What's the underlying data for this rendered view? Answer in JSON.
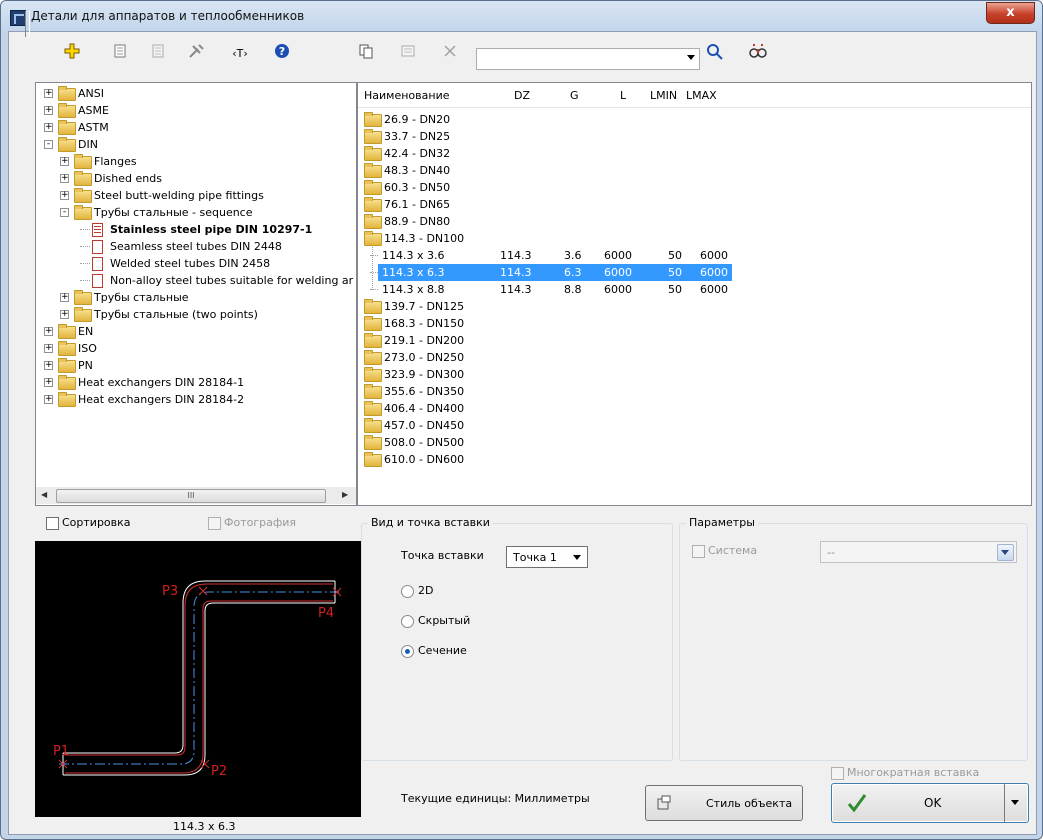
{
  "window": {
    "title": "Детали для аппаратов и теплообменников",
    "close_label": "x"
  },
  "toolbar": {
    "search_value": ""
  },
  "tree": {
    "scroll_label": "III",
    "items": [
      {
        "label": "ANSI",
        "level": 0,
        "type": "folder",
        "expander": "+"
      },
      {
        "label": "ASME",
        "level": 0,
        "type": "folder",
        "expander": "+"
      },
      {
        "label": "ASTM",
        "level": 0,
        "type": "folder",
        "expander": "+"
      },
      {
        "label": "DIN",
        "level": 0,
        "type": "folder-open",
        "expander": "-"
      },
      {
        "label": "Flanges",
        "level": 1,
        "type": "folder",
        "expander": "+"
      },
      {
        "label": "Dished ends",
        "level": 1,
        "type": "folder",
        "expander": "+"
      },
      {
        "label": "Steel butt-welding pipe fittings",
        "level": 1,
        "type": "folder",
        "expander": "+"
      },
      {
        "label": "Трубы стальные - sequence",
        "level": 1,
        "type": "folder-open",
        "expander": "-"
      },
      {
        "label": "Stainless steel pipe DIN 10297-1",
        "level": 2,
        "type": "doc-filled",
        "expander": "",
        "bold": true
      },
      {
        "label": "Seamless steel tubes DIN 2448",
        "level": 2,
        "type": "doc",
        "expander": ""
      },
      {
        "label": "Welded steel tubes DIN 2458",
        "level": 2,
        "type": "doc",
        "expander": ""
      },
      {
        "label": "Non-alloy steel tubes suitable for welding ar",
        "level": 2,
        "type": "doc",
        "expander": ""
      },
      {
        "label": "Трубы стальные",
        "level": 1,
        "type": "folder",
        "expander": "+"
      },
      {
        "label": "Трубы стальные (two points)",
        "level": 1,
        "type": "folder",
        "expander": "+"
      },
      {
        "label": "EN",
        "level": 0,
        "type": "folder",
        "expander": "+"
      },
      {
        "label": "ISO",
        "level": 0,
        "type": "folder",
        "expander": "+"
      },
      {
        "label": "PN",
        "level": 0,
        "type": "folder",
        "expander": "+"
      },
      {
        "label": "Heat exchangers DIN 28184-1",
        "level": 0,
        "type": "folder",
        "expander": "+"
      },
      {
        "label": "Heat exchangers DIN 28184-2",
        "level": 0,
        "type": "folder",
        "expander": "+"
      }
    ]
  },
  "list": {
    "columns": [
      "Наименование",
      "DZ",
      "G",
      "L",
      "LMIN",
      "LMAX"
    ],
    "rows": [
      {
        "name": "26.9 - DN20",
        "kind": "folder"
      },
      {
        "name": "33.7 - DN25",
        "kind": "folder"
      },
      {
        "name": "42.4 - DN32",
        "kind": "folder"
      },
      {
        "name": "48.3 - DN40",
        "kind": "folder"
      },
      {
        "name": "60.3 - DN50",
        "kind": "folder"
      },
      {
        "name": "76.1 - DN65",
        "kind": "folder"
      },
      {
        "name": "88.9 - DN80",
        "kind": "folder"
      },
      {
        "name": "114.3 - DN100",
        "kind": "folder-open"
      },
      {
        "name": "114.3 x 3.6",
        "kind": "item",
        "dz": "114.3",
        "g": "3.6",
        "l": "6000",
        "lmin": "50",
        "lmax": "6000"
      },
      {
        "name": "114.3 x 6.3",
        "kind": "item",
        "dz": "114.3",
        "g": "6.3",
        "l": "6000",
        "lmin": "50",
        "lmax": "6000",
        "selected": true
      },
      {
        "name": "114.3 x 8.8",
        "kind": "item",
        "dz": "114.3",
        "g": "8.8",
        "l": "6000",
        "lmin": "50",
        "lmax": "6000"
      },
      {
        "name": "139.7 - DN125",
        "kind": "folder"
      },
      {
        "name": "168.3 - DN150",
        "kind": "folder"
      },
      {
        "name": "219.1 - DN200",
        "kind": "folder"
      },
      {
        "name": "273.0 - DN250",
        "kind": "folder"
      },
      {
        "name": "323.9 - DN300",
        "kind": "folder"
      },
      {
        "name": "355.6 - DN350",
        "kind": "folder"
      },
      {
        "name": "406.4 - DN400",
        "kind": "folder"
      },
      {
        "name": "457.0 - DN450",
        "kind": "folder"
      },
      {
        "name": "508.0 - DN500",
        "kind": "folder"
      },
      {
        "name": "610.0 - DN600",
        "kind": "folder"
      }
    ]
  },
  "preview": {
    "sort_label": "Сортировка",
    "photo_label": "Фотография",
    "caption": "114.3 x 6.3",
    "points": [
      "P1",
      "P2",
      "P3",
      "P4"
    ]
  },
  "insert_group": {
    "title": "Вид и точка вставки",
    "point_label": "Точка вставки",
    "point_value": "Точка 1",
    "radios": [
      {
        "label": "2D",
        "checked": false
      },
      {
        "label": "Скрытый",
        "checked": false
      },
      {
        "label": "Сечение",
        "checked": true
      }
    ]
  },
  "params_group": {
    "title": "Параметры",
    "system_label": "Система",
    "system_value": "--"
  },
  "footer": {
    "multi_insert_label": "Многократная вставка",
    "units_text": "Текущие единицы: Миллиметры",
    "style_button": "Стиль объекта",
    "ok_button": "OK"
  }
}
